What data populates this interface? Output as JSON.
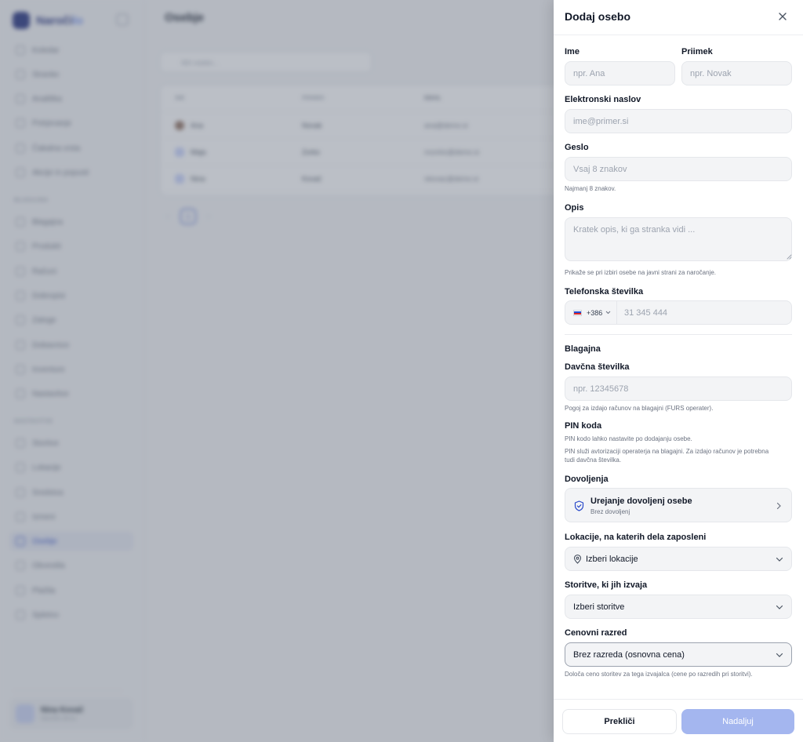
{
  "background_app": {
    "brand": {
      "name_dark": "Naroči",
      "name_light": "lo"
    },
    "nav_sections": [
      "BLAGAJNA",
      "NASTAVITVE"
    ],
    "nav_items": [
      "Koledar",
      "Stranke",
      "Analitika",
      "Potrjevanje",
      "Čakalna vrsta",
      "Akcije in popusti",
      "Blagajna",
      "Produkti",
      "Računi",
      "Dobropisi",
      "Zaloge",
      "Dobavnice",
      "Inventure",
      "Nastavitve",
      "Storitve",
      "Lokacije",
      "Sredstva",
      "Izmeni",
      "Osebje",
      "Obvestila",
      "Plačila",
      "Spletno"
    ],
    "page_title": "Osebje",
    "search_placeholder": "Išči osebo...",
    "table": {
      "headers": [
        "IME",
        "PRIIMEK",
        "EMAIL"
      ],
      "rows": [
        [
          "Ana",
          "Novak",
          "ana@demo.si"
        ],
        [
          "Maja",
          "Zorko",
          "mzorko@demo.si"
        ],
        [
          "Nina",
          "Kovač",
          "nkovac@demo.si"
        ]
      ]
    },
    "pagination": {
      "current": "1"
    },
    "user": {
      "name": "Nina Kovač",
      "subtitle": "Naročilo demo"
    }
  },
  "drawer": {
    "title": "Dodaj osebo",
    "first_name": {
      "label": "Ime",
      "placeholder": "npr. Ana",
      "value": ""
    },
    "last_name": {
      "label": "Priimek",
      "placeholder": "npr. Novak",
      "value": ""
    },
    "email": {
      "label": "Elektronski naslov",
      "placeholder": "ime@primer.si",
      "value": ""
    },
    "password": {
      "label": "Geslo",
      "placeholder": "Vsaj 8 znakov",
      "hint": "Najmanj 8 znakov."
    },
    "description": {
      "label": "Opis",
      "placeholder": "Kratek opis, ki ga stranka vidi ...",
      "hint": "Prikaže se pri izbiri osebe na javni strani za naročanje."
    },
    "phone": {
      "label": "Telefonska številka",
      "country": "SI",
      "dial_code": "+386",
      "placeholder": "31 345 444"
    },
    "cash_register": {
      "heading": "Blagajna",
      "tax_number": {
        "label": "Davčna številka",
        "placeholder": "npr. 12345678",
        "hint": "Pogoj za izdajo računov na blagajni (FURS operater)."
      },
      "pin": {
        "label": "PIN koda",
        "hint_1": "PIN kodo lahko nastavite po dodajanju osebe.",
        "hint_2a": "PIN služi avtorizaciji operaterja na blagajni. Za izdajo računov je potrebna",
        "hint_2b": "tudi davčna številka."
      }
    },
    "permissions": {
      "label": "Dovoljenja",
      "title": "Urejanje dovoljenj osebe",
      "subtitle": "Brez dovoljenj"
    },
    "locations": {
      "label": "Lokacije, na katerih dela zaposleni",
      "value": "Izberi lokacije"
    },
    "services": {
      "label": "Storitve, ki jih izvaja",
      "value": "Izberi storitve"
    },
    "price_tier": {
      "label": "Cenovni razred",
      "value": "Brez razreda (osnovna cena)",
      "hint": "Določa ceno storitev za tega izvajalca (cene po razredih pri storitvi)."
    },
    "footer": {
      "cancel": "Prekliči",
      "next": "Nadaljuj"
    }
  },
  "colors": {
    "primary": "#2848c9",
    "primary_disabled": "#a4b6ef",
    "overlay": "#6b7280"
  }
}
